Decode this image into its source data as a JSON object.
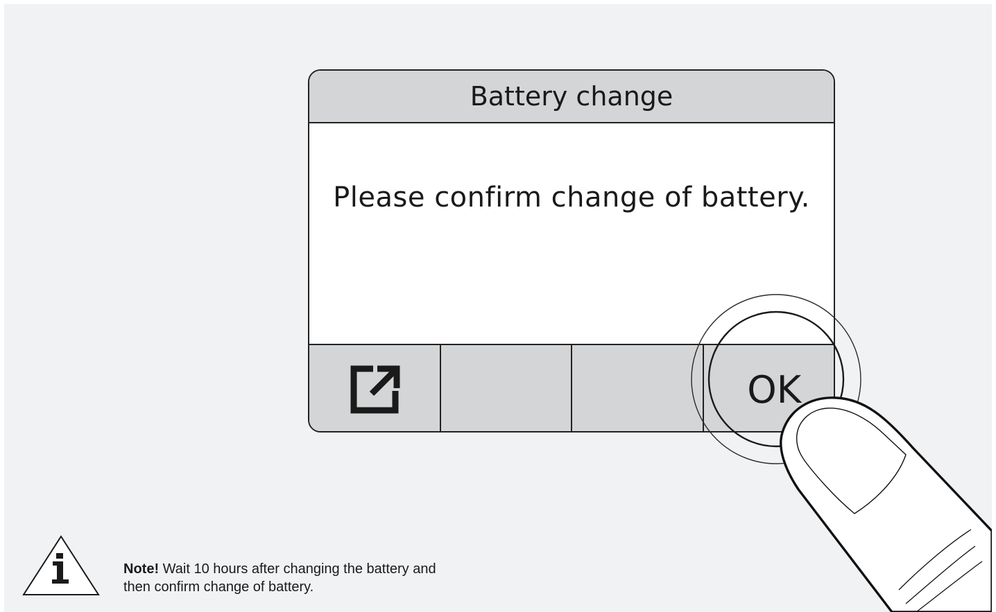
{
  "dialog": {
    "title": "Battery change",
    "message": "Please confirm change of battery."
  },
  "softkeys": [
    {
      "icon": "external-link-icon",
      "label": ""
    },
    {
      "icon": "",
      "label": ""
    },
    {
      "icon": "",
      "label": ""
    },
    {
      "icon": "",
      "label": "OK"
    }
  ],
  "note": {
    "bold": "Note!",
    "text": " Wait 10 hours after changing the battery and",
    "text2": "then confirm change of battery."
  },
  "colors": {
    "background": "#f1f2f4",
    "panel": "#d4d5d7",
    "outline": "#222222"
  }
}
